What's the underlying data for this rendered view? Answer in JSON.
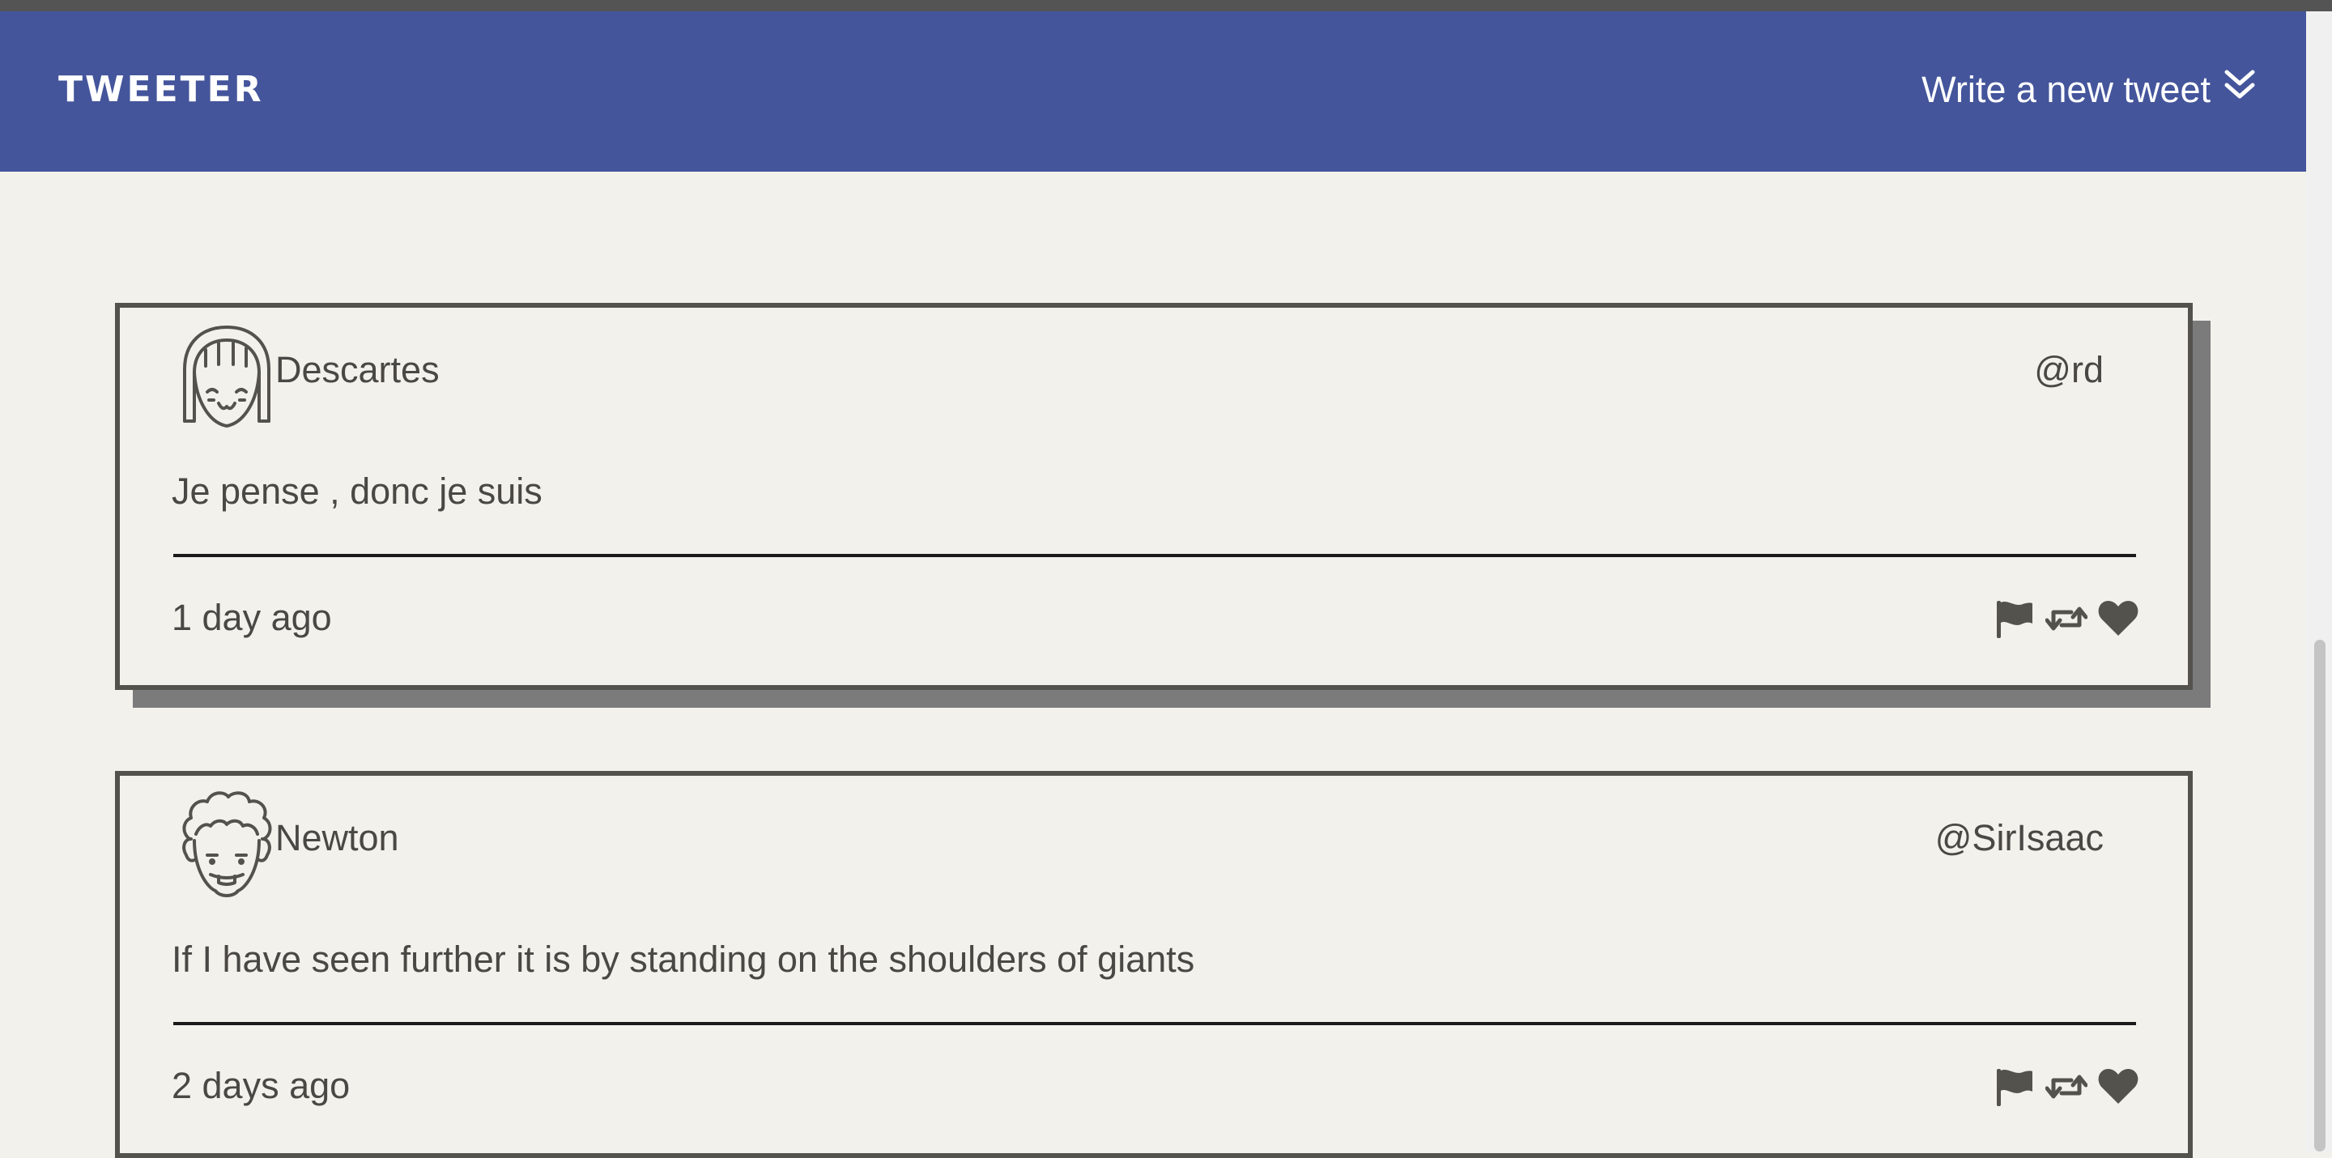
{
  "header": {
    "brand": "TWEETER",
    "compose_label": "Write a new tweet"
  },
  "colors": {
    "navbar": "#44559b",
    "background": "#f3f1ec",
    "text": "#4a4844",
    "border": "#54524c"
  },
  "tweets": [
    {
      "name": "Descartes",
      "handle": "@rd",
      "text": "Je pense , donc je suis",
      "time": "1 day ago",
      "avatar_icon": "girl-face-avatar-icon",
      "actions": [
        "flag-icon",
        "retweet-icon",
        "heart-icon"
      ]
    },
    {
      "name": "Newton",
      "handle": "@SirIsaac",
      "text": "If I have seen further it is by standing on the shoulders of giants",
      "time": "2 days ago",
      "avatar_icon": "curly-hair-face-avatar-icon",
      "actions": [
        "flag-icon",
        "retweet-icon",
        "heart-icon"
      ]
    }
  ]
}
